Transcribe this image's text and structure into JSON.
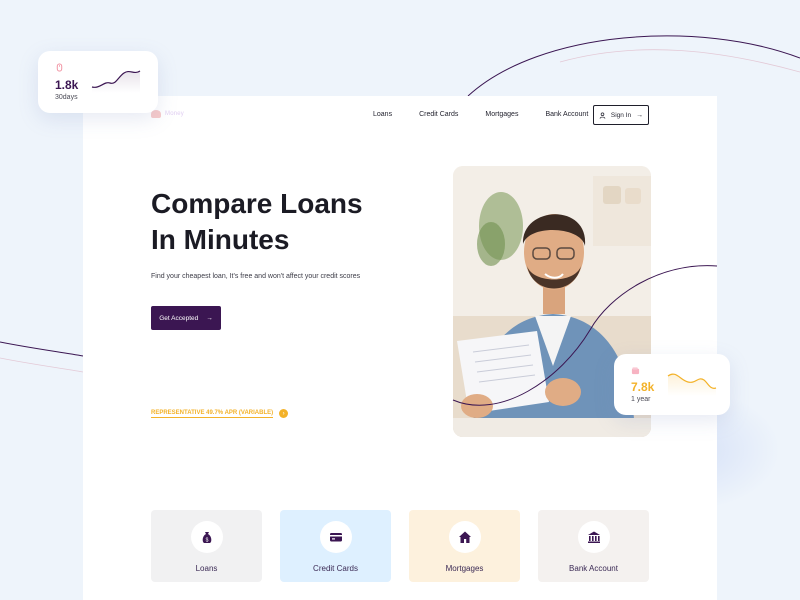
{
  "brand": {
    "name": "Money"
  },
  "nav": {
    "items": [
      {
        "label": "Loans"
      },
      {
        "label": "Credit Cards"
      },
      {
        "label": "Mortgages"
      },
      {
        "label": "Bank Account"
      }
    ],
    "signin_label": "Sign In"
  },
  "hero": {
    "title_line1": "Compare Loans",
    "title_line2": "In Minutes",
    "subtitle": "Find your cheapest loan, It's free and won't affect your credit scores",
    "cta_label": "Get Accepted",
    "apr_text": "REPRESENTATIVE 49.7% APR (VARIABLE)"
  },
  "stats": [
    {
      "value": "1.8k",
      "label": "30days",
      "accent": "#3b1652"
    },
    {
      "value": "7.8k",
      "label": "1 year",
      "accent": "#f3b229"
    }
  ],
  "categories": [
    {
      "label": "Loans",
      "icon": "money-bag-icon",
      "bg": "#f1f1f2"
    },
    {
      "label": "Credit Cards",
      "icon": "credit-card-icon",
      "bg": "#def0ff"
    },
    {
      "label": "Mortgages",
      "icon": "house-icon",
      "bg": "#fdf1dd"
    },
    {
      "label": "Bank Account",
      "icon": "bank-icon",
      "bg": "#f4f1ef"
    }
  ],
  "colors": {
    "accent_dark": "#3b1652",
    "accent_yellow": "#f3b229",
    "background": "#eef4fb"
  }
}
